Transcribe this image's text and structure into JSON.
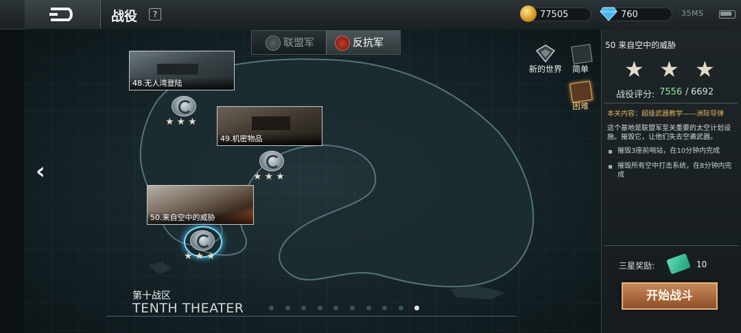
{
  "header": {
    "title": "战役",
    "help_label": "?",
    "gold": "77505",
    "gems": "760",
    "signal": "35MS"
  },
  "tabs": [
    {
      "label": "联盟军",
      "active": false
    },
    {
      "label": "反抗军",
      "active": true
    }
  ],
  "missions": [
    {
      "label": "48.无人湾登陆",
      "stars": "★★★"
    },
    {
      "label": "49.机密物品",
      "stars": "★★★"
    },
    {
      "label": "50.来自空中的威胁",
      "stars": "★★★",
      "selected": true
    }
  ],
  "side_buttons": {
    "new_world": "新的世界",
    "easy": "简单",
    "hard": "困难"
  },
  "theater": {
    "name_cn": "第十战区",
    "name_en": "TENTH THEATER",
    "page_count": 10,
    "active_page": 10
  },
  "panel": {
    "mission_name": "50 来自空中的威胁",
    "stars": [
      "★",
      "★",
      "★"
    ],
    "rating_label": "战役评分:",
    "rating_value": "7556",
    "rating_sep": "/",
    "rating_max": "6692",
    "content_label": "本关内容：超级武器教学——洲际导弹",
    "description": "这个基地是联盟军至关重要的太空计划设施。摧毁它，让他们失去空袭武器。",
    "objectives": [
      "摧毁3座前哨站，在10分钟内完成",
      "摧毁所有空中打击系统，在8分钟内完成"
    ],
    "reward_label": "三星奖励:",
    "reward_count": "10",
    "start_button": "开始战斗"
  },
  "colors": {
    "accent_gold": "#e4b55c",
    "rating_green": "#8ee8a0",
    "start_button": "#b06a3a"
  }
}
